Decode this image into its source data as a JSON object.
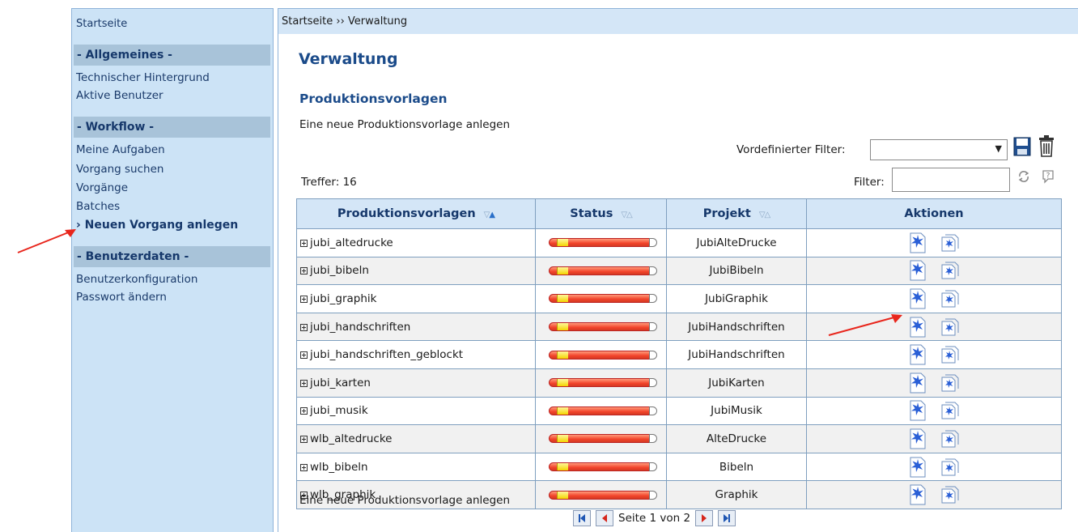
{
  "sidebar": {
    "home": "Startseite",
    "sections": [
      {
        "title": "- Allgemeines -",
        "links": [
          "Technischer Hintergrund",
          "Aktive Benutzer"
        ]
      },
      {
        "title": "- Workflow -",
        "links": [
          "Meine Aufgaben",
          "Vorgang suchen",
          "Vorgänge",
          "Batches"
        ]
      },
      {
        "title": "- Benutzerdaten -",
        "links": [
          "Benutzerkonfiguration",
          "Passwort ändern"
        ]
      }
    ],
    "active_link": "› Neuen Vorgang anlegen"
  },
  "breadcrumb": "Startseite ›› Verwaltung",
  "page_title": "Verwaltung",
  "section_title": "Produktionsvorlagen",
  "new_template_link": "Eine neue Produktionsvorlage anlegen",
  "filter": {
    "preset_label": "Vordefinierter Filter:",
    "preset_value": "",
    "label": "Filter:",
    "value": ""
  },
  "hits": "Treffer: 16",
  "table": {
    "headers": [
      "Produktionsvorlagen",
      "Status",
      "Projekt",
      "Aktionen"
    ],
    "rows": [
      {
        "name": "jubi_altedrucke",
        "project": "JubiAlteDrucke"
      },
      {
        "name": "jubi_bibeln",
        "project": "JubiBibeln"
      },
      {
        "name": "jubi_graphik",
        "project": "JubiGraphik"
      },
      {
        "name": "jubi_handschriften",
        "project": "JubiHandschriften"
      },
      {
        "name": "jubi_handschriften_geblockt",
        "project": "JubiHandschriften"
      },
      {
        "name": "jubi_karten",
        "project": "JubiKarten"
      },
      {
        "name": "jubi_musik",
        "project": "JubiMusik"
      },
      {
        "name": "wlb_altedrucke",
        "project": "AlteDrucke"
      },
      {
        "name": "wlb_bibeln",
        "project": "Bibeln"
      },
      {
        "name": "wlb_graphik",
        "project": "Graphik"
      }
    ]
  },
  "pagination": {
    "text": "Seite 1 von 2"
  },
  "colors": {
    "sidebar_bg": "#cce3f6",
    "section_bg": "#a8c3d9",
    "heading": "#1b4b8a",
    "annotation_arrow": "#e8261c"
  },
  "icons": {
    "save": "save-icon",
    "trash": "trash-icon",
    "refresh": "refresh-icon",
    "help": "help-icon",
    "new_process": "new-process-icon",
    "batch_new_process": "mass-import-icon"
  }
}
